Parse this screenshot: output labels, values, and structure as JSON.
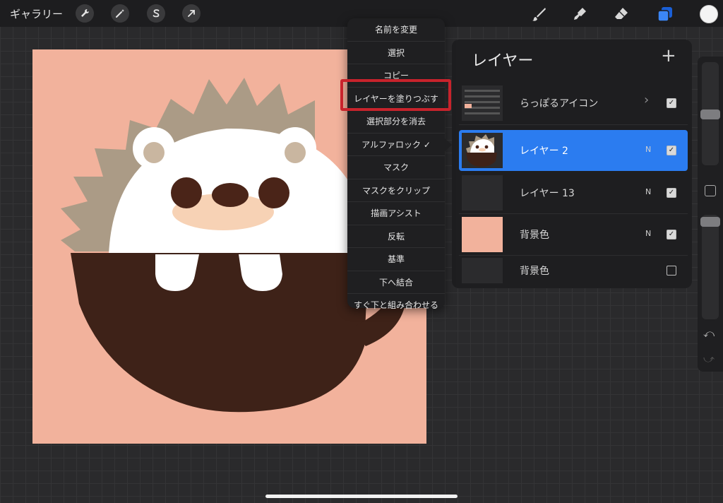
{
  "topbar": {
    "gallery_label": "ギャラリー",
    "left_tools": [
      "wrench-icon",
      "magic-wand-icon",
      "selection-s-icon",
      "transform-arrow-icon"
    ],
    "right_tools": [
      "brush-icon",
      "smudge-icon",
      "eraser-icon",
      "layers-icon"
    ],
    "accent_color": "#2b7cf0",
    "active_color": "#f4f4f4"
  },
  "context_menu": {
    "items": [
      "名前を変更",
      "選択",
      "コピー",
      "レイヤーを塗りつぶす",
      "選択部分を消去",
      "アルファロック ✓",
      "マスク",
      "マスクをクリップ",
      "描画アシスト",
      "反転",
      "基準",
      "下へ結合",
      "すぐ下と組み合わせる"
    ],
    "highlighted_item": "レイヤーを塗りつぶす",
    "highlight_color": "#c8232c"
  },
  "layers_panel": {
    "title": "レイヤー",
    "add_label": "+",
    "layers": [
      {
        "name": "らっぽるアイコン",
        "blend": "",
        "checked": true,
        "group": true,
        "selected": false
      },
      {
        "name": "レイヤー 2",
        "blend": "N",
        "checked": true,
        "group": false,
        "selected": true
      },
      {
        "name": "レイヤー 13",
        "blend": "N",
        "checked": true,
        "group": false,
        "selected": false
      },
      {
        "name": "背景色",
        "blend": "N",
        "checked": true,
        "group": false,
        "selected": false
      },
      {
        "name": "背景色",
        "blend": "",
        "checked": false,
        "group": false,
        "selected": false
      }
    ]
  },
  "canvas": {
    "background_color": "#f2b29c",
    "illustration": "hedgehog-illustration"
  },
  "sidebar": {
    "undo_icon": "undo-icon",
    "redo_icon": "redo-icon",
    "brush_size_level": 0.25,
    "opacity_level": 0.05
  }
}
